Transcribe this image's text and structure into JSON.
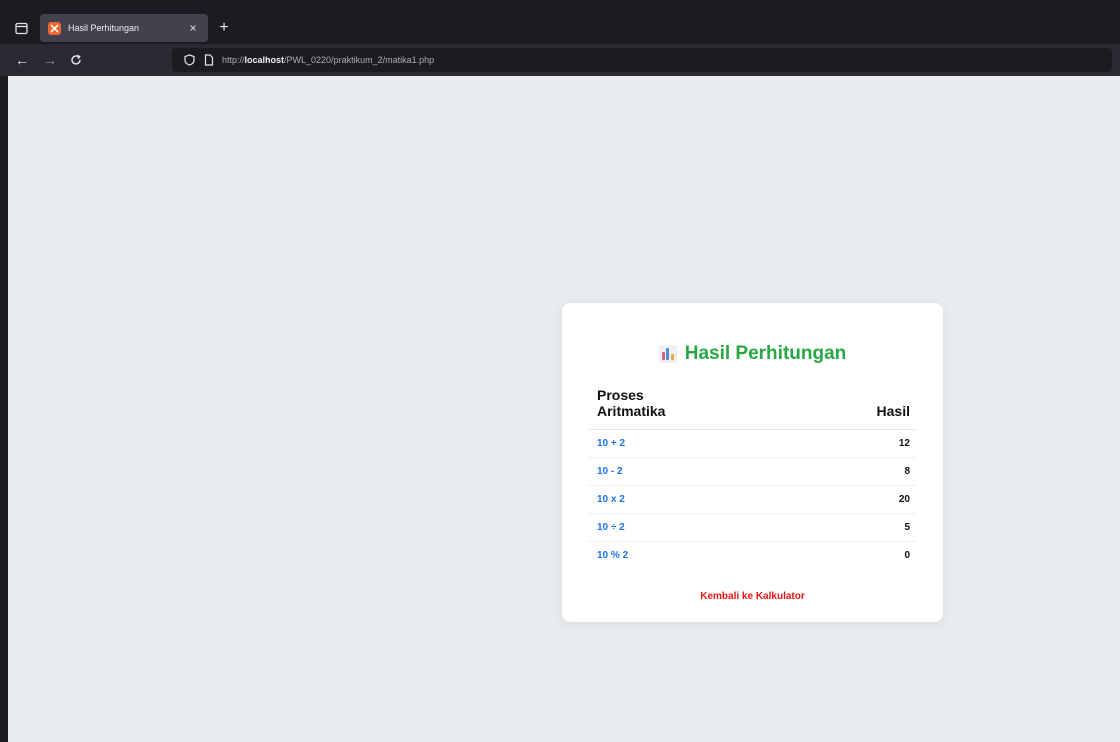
{
  "browser": {
    "tab_title": "Hasil Perhitungan",
    "url_scheme": "http://",
    "url_host": "localhost",
    "url_path": "/PWL_0220/praktikum_2/matika1.php"
  },
  "card": {
    "title": "Hasil Perhitungan",
    "header_process": "Proses Aritmatika",
    "header_result": "Hasil",
    "rows": [
      {
        "process": "10 + 2",
        "result": "12"
      },
      {
        "process": "10 - 2",
        "result": "8"
      },
      {
        "process": "10 x 2",
        "result": "20"
      },
      {
        "process": "10 ÷ 2",
        "result": "5"
      },
      {
        "process": "10 % 2",
        "result": "0"
      }
    ],
    "back_link": "Kembali ke Kalkulator"
  },
  "colors": {
    "title_green": "#28a745",
    "process_blue": "#1a73e8",
    "link_red": "#e81414",
    "page_bg": "#e9ecef"
  }
}
